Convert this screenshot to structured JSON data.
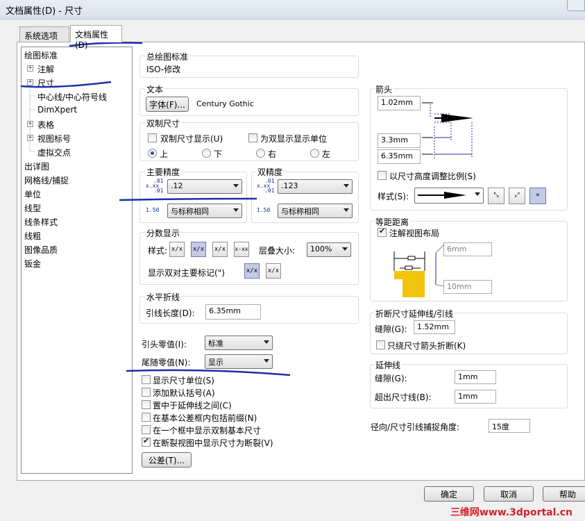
{
  "window": {
    "title": "文档属性(D) - 尺寸"
  },
  "tabs": [
    {
      "label": "系统选项(S)"
    },
    {
      "label": "文档属性(D)"
    }
  ],
  "tree": [
    {
      "label": "绘图标准"
    },
    {
      "label": "注解"
    },
    {
      "label": "尺寸"
    },
    {
      "label": "中心线/中心符号线"
    },
    {
      "label": "DimXpert"
    },
    {
      "label": "表格"
    },
    {
      "label": "视图标号"
    },
    {
      "label": "虚拟交点"
    },
    {
      "label": "出详图"
    },
    {
      "label": "网格线/捕捉"
    },
    {
      "label": "单位"
    },
    {
      "label": "线型"
    },
    {
      "label": "线条样式"
    },
    {
      "label": "线粗"
    },
    {
      "label": "图像品质"
    },
    {
      "label": "钣金"
    }
  ],
  "overall_standard": {
    "label": "总绘图标准",
    "value": "ISO-修改"
  },
  "text_group": {
    "label": "文本",
    "font_button": "字体(F)...",
    "font_name": "Century Gothic"
  },
  "dual": {
    "label": "双制尺寸",
    "show_dual": "双制尺寸显示(U)",
    "show_units": "为双显示显示单位",
    "radios": [
      {
        "label": "上"
      },
      {
        "label": "下"
      },
      {
        "label": "右"
      },
      {
        "label": "左"
      }
    ]
  },
  "primary_precision": {
    "label": "主要精度",
    "value": ".12",
    "tolerance": "与标称相同",
    "icon_value": "x.xx",
    "icon_sub": ".01",
    "icon_tol": "1.50"
  },
  "dual_precision": {
    "label": "双精度",
    "value": ".123",
    "tolerance": "与标称相同"
  },
  "fraction": {
    "label": "分数显示",
    "style_label": "样式:",
    "stack_label": "层叠大小:",
    "stack_value": "100%",
    "dual_label": "显示双对主要标记(\")",
    "styles": [
      "x/x",
      "x-x",
      "x-xx"
    ]
  },
  "horizontal": {
    "label": "水平折线",
    "leader_label": "引线长度(D):",
    "leader_value": "6.35mm"
  },
  "leading_zero": {
    "label": "引头零值(I):",
    "value": "标准"
  },
  "trailing_zero": {
    "label": "尾随零值(N):",
    "value": "显示"
  },
  "checkboxes": [
    {
      "label": "显示尺寸单位(S)",
      "checked": false
    },
    {
      "label": "添加默认括号(A)",
      "checked": false
    },
    {
      "label": "置中于延伸线之间(C)",
      "checked": false
    },
    {
      "label": "在基本公差框内包括前缀(N)",
      "checked": false
    },
    {
      "label": "在一个框中显示双制基本尺寸",
      "checked": false
    },
    {
      "label": "在断裂视图中显示尺寸为断裂(V)",
      "checked": true
    }
  ],
  "tolerance_button": "公差(T)...",
  "arrows": {
    "label": "箭头",
    "size1": "1.02mm",
    "size2": "3.3mm",
    "size3": "6.35mm",
    "scale_label": "以尺寸高度调整比例(S)",
    "style_label": "样式(S):"
  },
  "spacing": {
    "label": "等距距离",
    "layout_label": "注解视图布局",
    "value1": "6mm",
    "value2": "10mm"
  },
  "break": {
    "label": "折断尺寸延伸线/引线",
    "gap_label": "缝隙(G):",
    "gap_value": "1.52mm",
    "only_arrow": "只绕尺寸箭头折断(K)"
  },
  "extension": {
    "label": "延伸线",
    "gap_label": "缝隙(G):",
    "gap_value": "1mm",
    "over_label": "超出尺寸线(B):",
    "over_value": "1mm"
  },
  "radial": {
    "label": "径向/尺寸引线捕捉角度:",
    "value": "15度"
  },
  "footer": {
    "ok": "确定",
    "cancel": "取消",
    "help": "帮助"
  },
  "watermark": "三维网www.3dportal.cn",
  "colors": {
    "annotation_pen": "#1a2fa8",
    "accent": "#1a59b6"
  }
}
